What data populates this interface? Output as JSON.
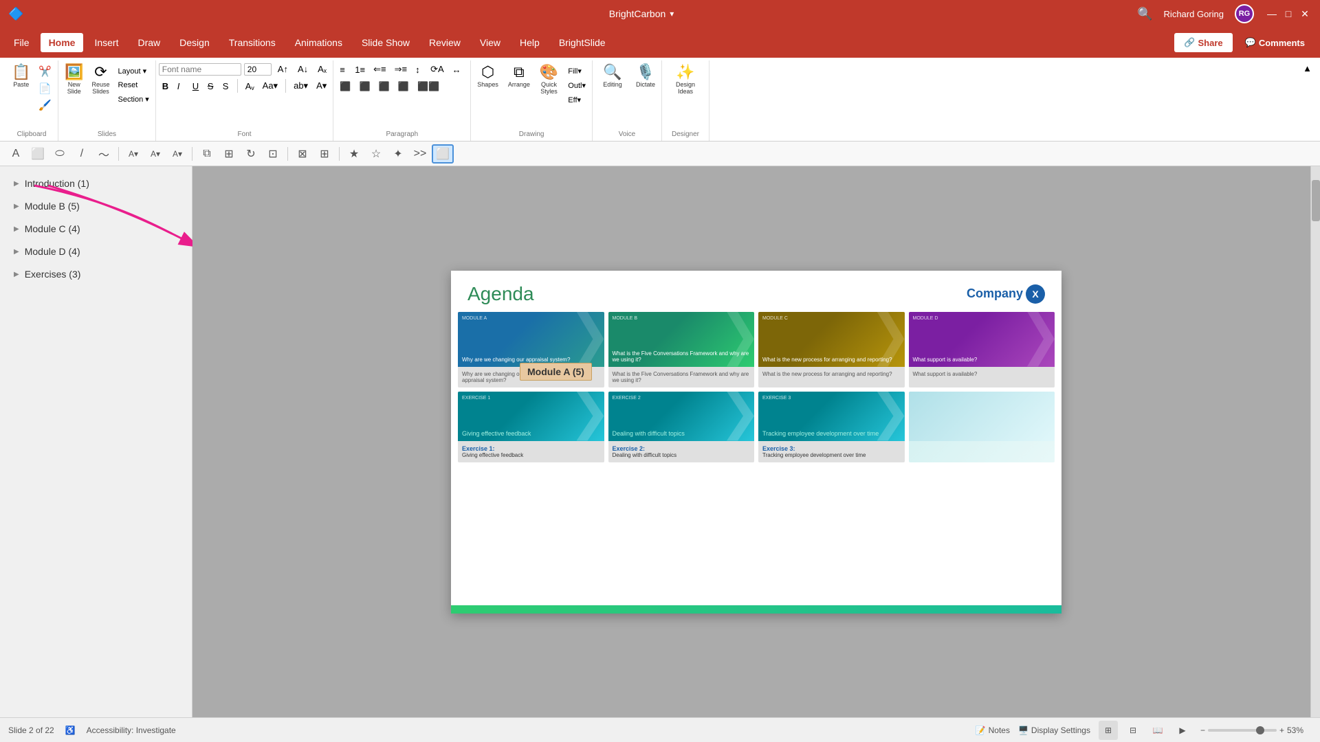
{
  "titlebar": {
    "app_name": "BrightCarbon",
    "dropdown_icon": "▾",
    "search_icon": "🔍",
    "user_name": "Richard Goring",
    "user_initials": "RG",
    "minimize": "—",
    "maximize": "□",
    "close": "✕"
  },
  "menubar": {
    "items": [
      {
        "label": "File",
        "active": false
      },
      {
        "label": "Home",
        "active": true
      },
      {
        "label": "Insert",
        "active": false
      },
      {
        "label": "Draw",
        "active": false
      },
      {
        "label": "Design",
        "active": false
      },
      {
        "label": "Transitions",
        "active": false
      },
      {
        "label": "Animations",
        "active": false
      },
      {
        "label": "Slide Show",
        "active": false
      },
      {
        "label": "Review",
        "active": false
      },
      {
        "label": "View",
        "active": false
      },
      {
        "label": "Help",
        "active": false
      },
      {
        "label": "BrightSlide",
        "active": false
      }
    ],
    "share_label": "Share",
    "comments_label": "Comments"
  },
  "ribbon": {
    "clipboard": {
      "label": "Clipboard",
      "paste": "Paste",
      "cut": "Cut",
      "copy": "Copy",
      "format_painter": "Format Painter"
    },
    "slides": {
      "label": "Slides",
      "new_slide": "New\nSlide",
      "reuse_slides": "Reuse\nSlides",
      "layout": "Layout",
      "reset": "Reset",
      "section": "Section"
    },
    "font": {
      "label": "Font",
      "font_name": "",
      "font_size": "20",
      "bold": "B",
      "italic": "I",
      "underline": "U",
      "strikethrough": "S",
      "shadow": "S",
      "increase_size": "A↑",
      "decrease_size": "A↓",
      "clear_format": "A×"
    },
    "paragraph": {
      "label": "Paragraph",
      "bullets": "≡",
      "numbering": "1≡",
      "indent_decrease": "⇐",
      "indent_increase": "⇒"
    },
    "drawing": {
      "label": "Drawing",
      "shapes": "Shapes",
      "arrange": "Arrange",
      "quick_styles": "Quick\nStyles"
    },
    "voice": {
      "label": "Voice",
      "editing": "Editing",
      "dictate": "Dictate"
    },
    "designer": {
      "label": "Designer",
      "design_ideas": "Design\nIdeas"
    }
  },
  "sidebar": {
    "items": [
      {
        "label": "Introduction (1)",
        "expanded": false
      },
      {
        "label": "Module B (5)",
        "expanded": false
      },
      {
        "label": "Module C (4)",
        "expanded": false
      },
      {
        "label": "Module D (4)",
        "expanded": false
      },
      {
        "label": "Exercises (3)",
        "expanded": false
      }
    ]
  },
  "slide": {
    "title": "Agenda",
    "company_name": "Company",
    "company_x": "X",
    "modules": [
      {
        "id": "module_a",
        "label": "MODULE A",
        "subtitle": "Why are we changing our appraisal system?",
        "img_class": "module-card-img-a",
        "question": "Why are we changing our\nappraisal system?"
      },
      {
        "id": "module_b",
        "label": "MODULE B",
        "subtitle": "What is the Five Conversations Framework and why are we using it?",
        "img_class": "module-card-img-b",
        "question": "What is the Five Conversations Framework and why are we using it?"
      },
      {
        "id": "module_c",
        "label": "MODULE C",
        "subtitle": "What is the new process for arranging and reporting?",
        "img_class": "module-card-img-c",
        "question": "What is the new process for arranging and reporting?"
      },
      {
        "id": "module_d",
        "label": "MODULE D",
        "subtitle": "What support is available?",
        "img_class": "module-card-img-d",
        "question": "What support is available?"
      }
    ],
    "exercises": [
      {
        "id": "exercise_1",
        "label": "EXERCISE 1",
        "subtitle": "Giving effective feedback",
        "img_class": "module-card-img-e1",
        "title_bold": "Exercise 1:",
        "desc": "Giving effective feedback"
      },
      {
        "id": "exercise_2",
        "label": "EXERCISE 2",
        "subtitle": "Dealing with difficult topics",
        "img_class": "module-card-img-e2",
        "title_bold": "Exercise 2:",
        "desc": "Dealing with difficult topics"
      },
      {
        "id": "exercise_3",
        "label": "EXERCISE 3",
        "subtitle": "Tracking employee development over time",
        "img_class": "module-card-img-e3",
        "title_bold": "Exercise 3:",
        "desc": "Tracking employee development over time"
      }
    ],
    "tooltip": "Module A (5)"
  },
  "statusbar": {
    "slide_info": "Slide 2 of 22",
    "accessibility": "Accessibility: Investigate",
    "notes": "Notes",
    "display_settings": "Display Settings",
    "zoom": "53%"
  }
}
